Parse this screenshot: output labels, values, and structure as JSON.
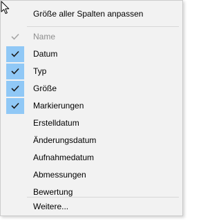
{
  "menu": {
    "top_item": "Größe aller Spalten anpassen",
    "columns": [
      {
        "label": "Name",
        "checked": true,
        "disabled": true
      },
      {
        "label": "Datum",
        "checked": true,
        "disabled": false
      },
      {
        "label": "Typ",
        "checked": true,
        "disabled": false
      },
      {
        "label": "Größe",
        "checked": true,
        "disabled": false
      },
      {
        "label": "Markierungen",
        "checked": true,
        "disabled": false
      },
      {
        "label": "Erstelldatum",
        "checked": false,
        "disabled": false
      },
      {
        "label": "Änderungsdatum",
        "checked": false,
        "disabled": false
      },
      {
        "label": "Aufnahmedatum",
        "checked": false,
        "disabled": false
      },
      {
        "label": "Abmessungen",
        "checked": false,
        "disabled": false
      },
      {
        "label": "Bewertung",
        "checked": false,
        "disabled": false
      }
    ],
    "more_item": "Weitere..."
  },
  "colors": {
    "menu_background": "#f2f2f2",
    "check_highlight": "#90c8f6",
    "disabled_text": "#8d8d8d",
    "separator": "#d7d7d7"
  },
  "icons": {
    "cursor": "mouse-pointer-icon",
    "check": "checkmark-icon"
  }
}
